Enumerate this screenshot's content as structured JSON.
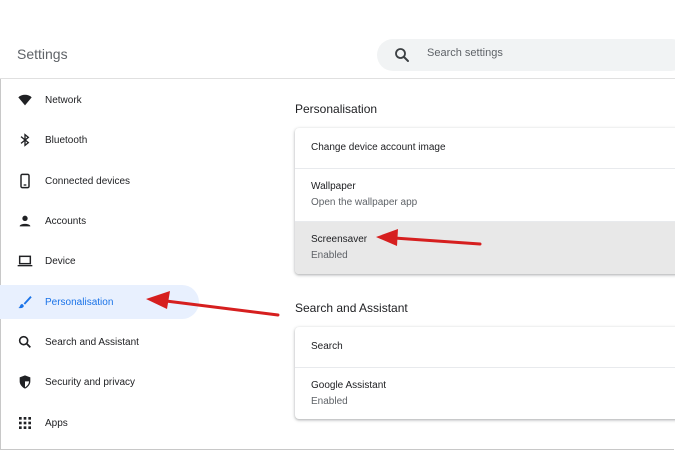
{
  "header": {
    "title": "Settings",
    "search_placeholder": "Search settings"
  },
  "sidebar": {
    "items": [
      {
        "label": "Network",
        "icon": "wifi-icon"
      },
      {
        "label": "Bluetooth",
        "icon": "bluetooth-icon"
      },
      {
        "label": "Connected devices",
        "icon": "phone-icon"
      },
      {
        "label": "Accounts",
        "icon": "person-icon"
      },
      {
        "label": "Device",
        "icon": "laptop-icon"
      },
      {
        "label": "Personalisation",
        "icon": "brush-icon",
        "selected": true
      },
      {
        "label": "Search and Assistant",
        "icon": "search-icon"
      },
      {
        "label": "Security and privacy",
        "icon": "shield-icon"
      },
      {
        "label": "Apps",
        "icon": "apps-grid-icon"
      }
    ]
  },
  "main": {
    "personalisation": {
      "title": "Personalisation",
      "rows": [
        {
          "title": "Change device account image"
        },
        {
          "title": "Wallpaper",
          "subtitle": "Open the wallpaper app"
        },
        {
          "title": "Screensaver",
          "subtitle": "Enabled"
        }
      ]
    },
    "search_assistant": {
      "title": "Search and Assistant",
      "rows": [
        {
          "title": "Search"
        },
        {
          "title": "Google Assistant",
          "subtitle": "Enabled"
        }
      ]
    }
  },
  "colors": {
    "accent": "#1a73e8",
    "selected_bg": "#e8f0fe",
    "annotation_arrow": "#d61f1f"
  }
}
